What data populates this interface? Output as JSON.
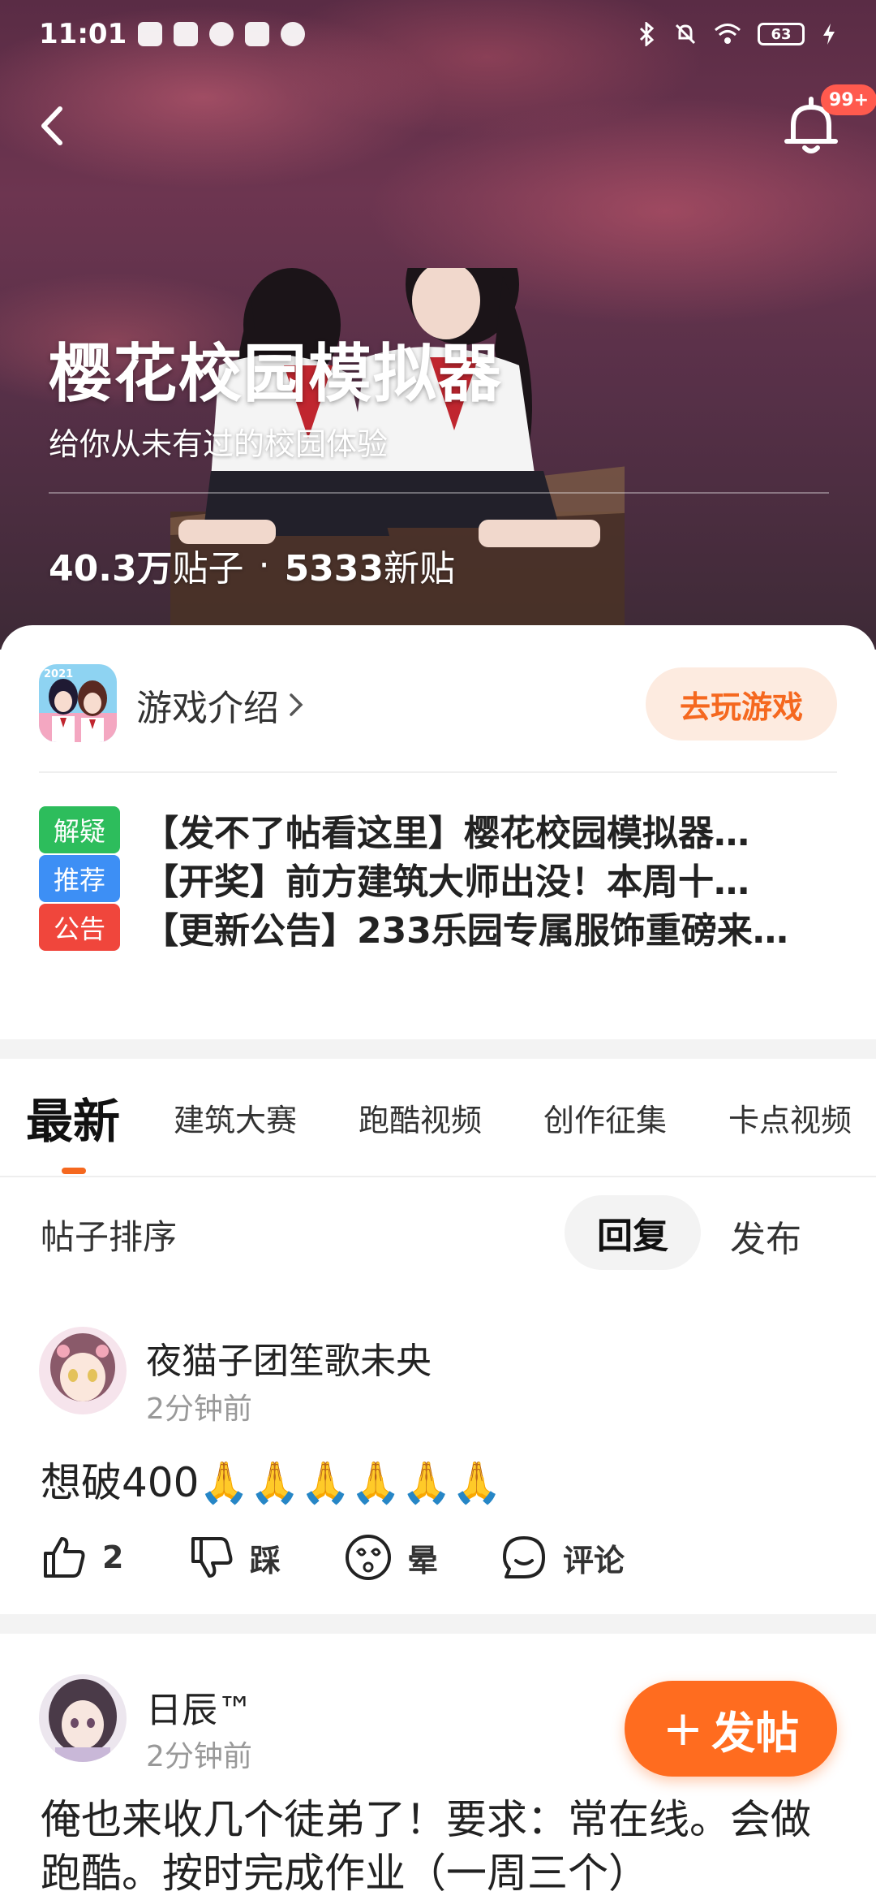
{
  "status_bar": {
    "time": "11:01",
    "battery": "63"
  },
  "header": {
    "notification_badge": "99+"
  },
  "forum": {
    "title": "樱花校园模拟器",
    "subtitle": "给你从未有过的校园体验",
    "posts_count": "40.3万",
    "posts_unit": "贴子",
    "separator": "·",
    "new_count": "5333",
    "new_unit": "新贴"
  },
  "game": {
    "icon_label": "2021",
    "intro_label": "游戏介绍",
    "play_button": "去玩游戏"
  },
  "notices": [
    {
      "tag": "解疑",
      "tag_color": "#2dbd5c",
      "text": "【发不了帖看这里】樱花校园模拟器…"
    },
    {
      "tag": "推荐",
      "tag_color": "#3d8ff5",
      "text": "【开奖】前方建筑大师出没！本周十…"
    },
    {
      "tag": "公告",
      "tag_color": "#f0463c",
      "text": "【更新公告】233乐园专属服饰重磅来…"
    }
  ],
  "tabs": [
    "最新",
    "建筑大赛",
    "跑酷视频",
    "创作征集",
    "卡点视频"
  ],
  "sort": {
    "label": "帖子排序",
    "reply": "回复",
    "publish": "发布"
  },
  "posts": [
    {
      "username": "夜猫子团笙歌未央",
      "time": "2分钟前",
      "content": "想破400🙏🙏🙏🙏🙏🙏",
      "likes": "2",
      "dislike_label": "踩",
      "dizzy_label": "晕",
      "comment_label": "评论"
    },
    {
      "username": "日辰™",
      "time": "2分钟前",
      "content": "俺也来收几个徒弟了！要求：常在线。会做跑酷。按时完成作业（一周三个）"
    }
  ],
  "fab": {
    "plus": "+",
    "label": "发帖"
  },
  "colors": {
    "accent": "#ff6c1f",
    "play_bg": "#fdebe0"
  }
}
